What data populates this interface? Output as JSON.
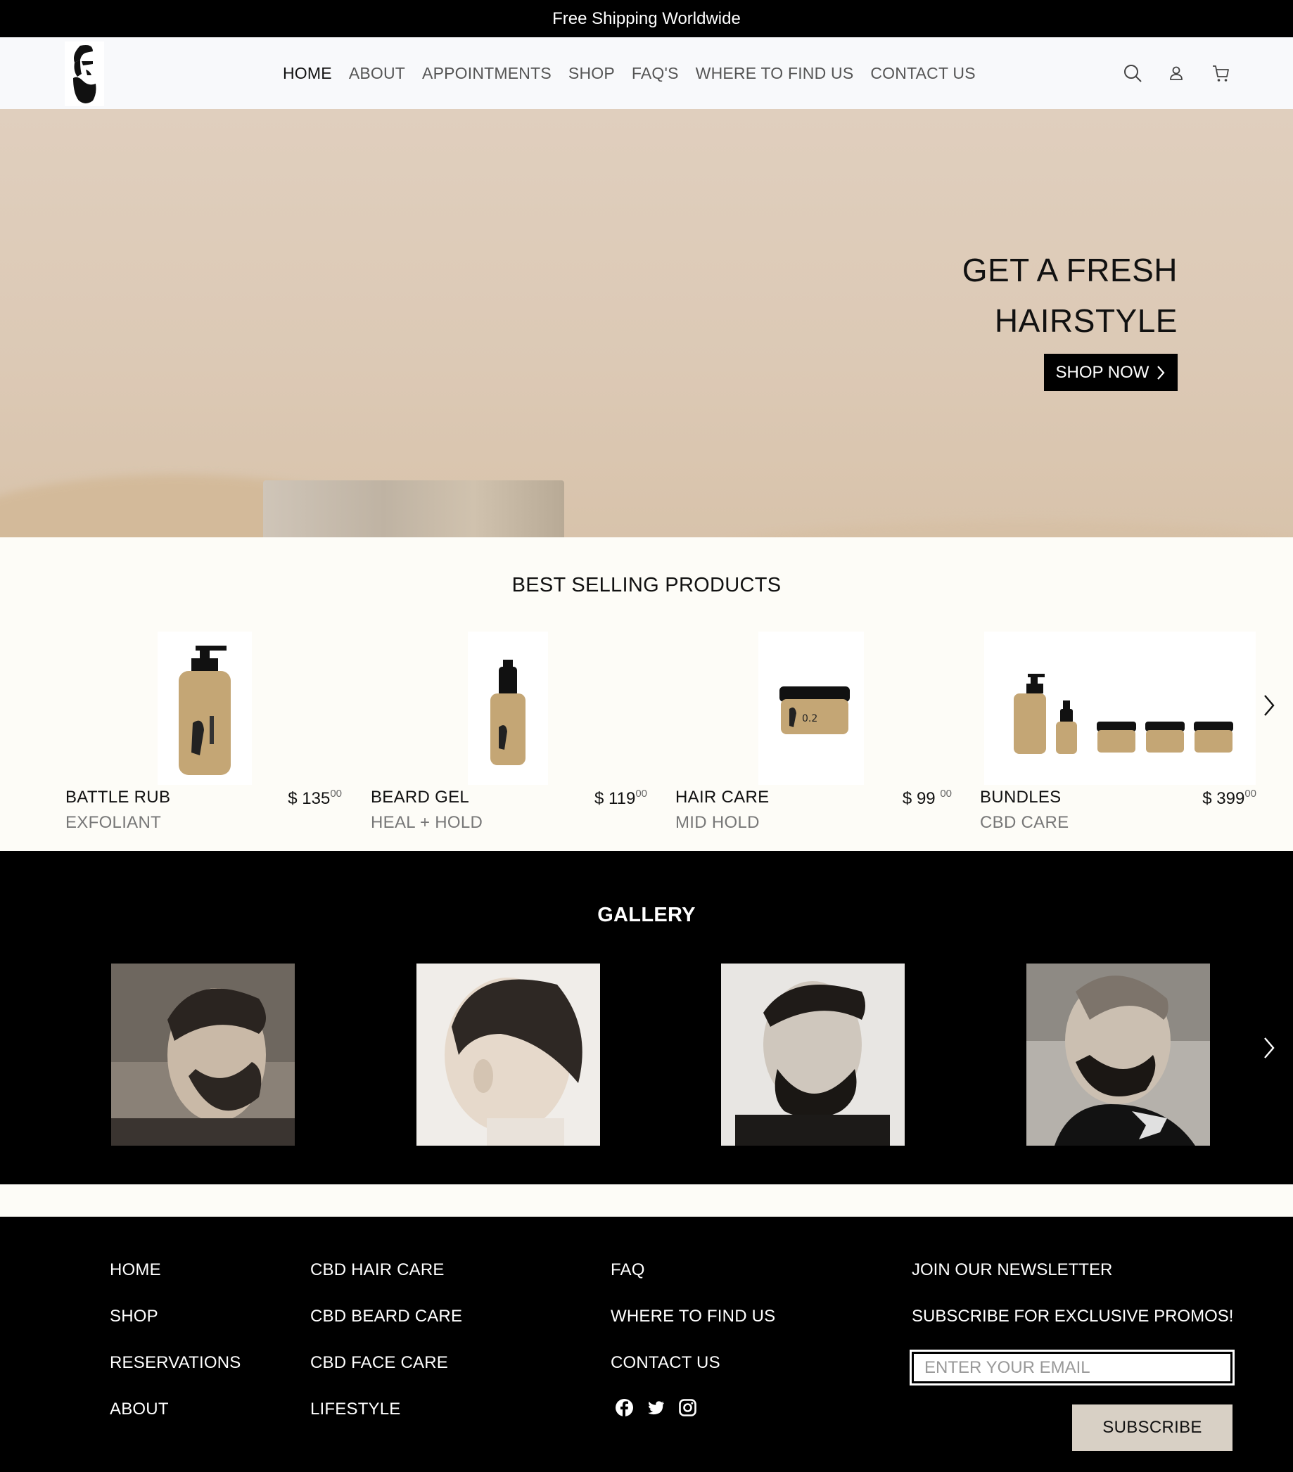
{
  "announcement": "Free Shipping Worldwide",
  "nav": {
    "items": [
      "HOME",
      "ABOUT",
      "APPOINTMENTS",
      "SHOP",
      "FAQ'S",
      "WHERE TO FIND US",
      "CONTACT US"
    ],
    "active": "HOME"
  },
  "header_icons": [
    "search-icon",
    "account-icon",
    "cart-icon"
  ],
  "hero": {
    "title_line1": "GET A FRESH",
    "title_line2": "HAIRSTYLE",
    "button_label": "SHOP NOW"
  },
  "best_selling": {
    "title": "BEST SELLING PRODUCTS",
    "products": [
      {
        "name": "BATTLE RUB",
        "subtitle": "EXFOLIANT",
        "currency": "$",
        "price_whole": "135",
        "price_cents": "00"
      },
      {
        "name": "BEARD GEL",
        "subtitle": "HEAL + HOLD",
        "currency": "$",
        "price_whole": "119",
        "price_cents": "00"
      },
      {
        "name": "HAIR CARE",
        "subtitle": "MID HOLD",
        "currency": "$",
        "price_whole": "99",
        "price_cents": "00"
      },
      {
        "name": "BUNDLES",
        "subtitle": "CBD CARE",
        "currency": "$",
        "price_whole": "399",
        "price_cents": "00"
      }
    ]
  },
  "gallery": {
    "title": "GALLERY",
    "images": [
      "barber-photo-1",
      "barber-photo-2",
      "barber-photo-3",
      "barber-photo-4"
    ]
  },
  "footer": {
    "col1": [
      "HOME",
      "SHOP",
      "RESERVATIONS",
      "ABOUT"
    ],
    "col2": [
      "CBD HAIR CARE",
      "CBD BEARD CARE",
      "CBD FACE CARE",
      "LIFESTYLE"
    ],
    "col3": [
      "FAQ",
      "WHERE TO FIND US",
      "CONTACT US"
    ],
    "social_icons": [
      "facebook-icon",
      "twitter-icon",
      "instagram-icon"
    ],
    "newsletter": {
      "title": "JOIN OUR NEWSLETTER",
      "subtitle": "SUBSCRIBE FOR EXCLUSIVE PROMOS!",
      "placeholder": "ENTER YOUR EMAIL",
      "button_label": "SUBSCRIBE"
    }
  },
  "colors": {
    "black": "#000000",
    "hero_bg": "#dcc9b5",
    "section_bg": "#fdfcf7",
    "subscribe_bg": "#d8d0c5",
    "product_tan": "#c4a675"
  }
}
